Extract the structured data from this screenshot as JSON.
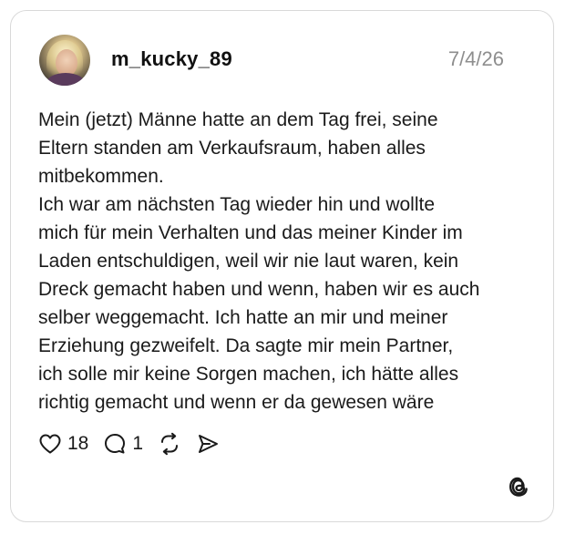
{
  "post": {
    "username": "m_kucky_89",
    "date": "7/4/26",
    "text_lines": [
      "Mein (jetzt) Männe hatte an dem Tag frei, seine",
      "Eltern standen am Verkaufsraum, haben alles",
      "mitbekommen.",
      "Ich war am nächsten Tag wieder hin und wollte",
      "mich für mein Verhalten und das meiner Kinder im",
      "Laden entschuldigen, weil wir nie laut waren, kein",
      "Dreck gemacht haben und wenn, haben wir es auch",
      "selber weggemacht. Ich hatte an mir und meiner",
      "Erziehung gezweifelt. Da sagte mir mein Partner,",
      "ich solle mir keine Sorgen machen, ich hätte alles",
      "richtig gemacht und wenn er da gewesen wäre"
    ],
    "likes": "18",
    "replies": "1"
  },
  "icons": {
    "like": "heart-icon",
    "reply": "comment-icon",
    "repost": "repost-icon",
    "share": "send-icon",
    "brand": "threads-logo-icon"
  },
  "colors": {
    "text": "#1a1a1a",
    "muted": "#8e8e8e",
    "border": "#d9d9d9"
  }
}
